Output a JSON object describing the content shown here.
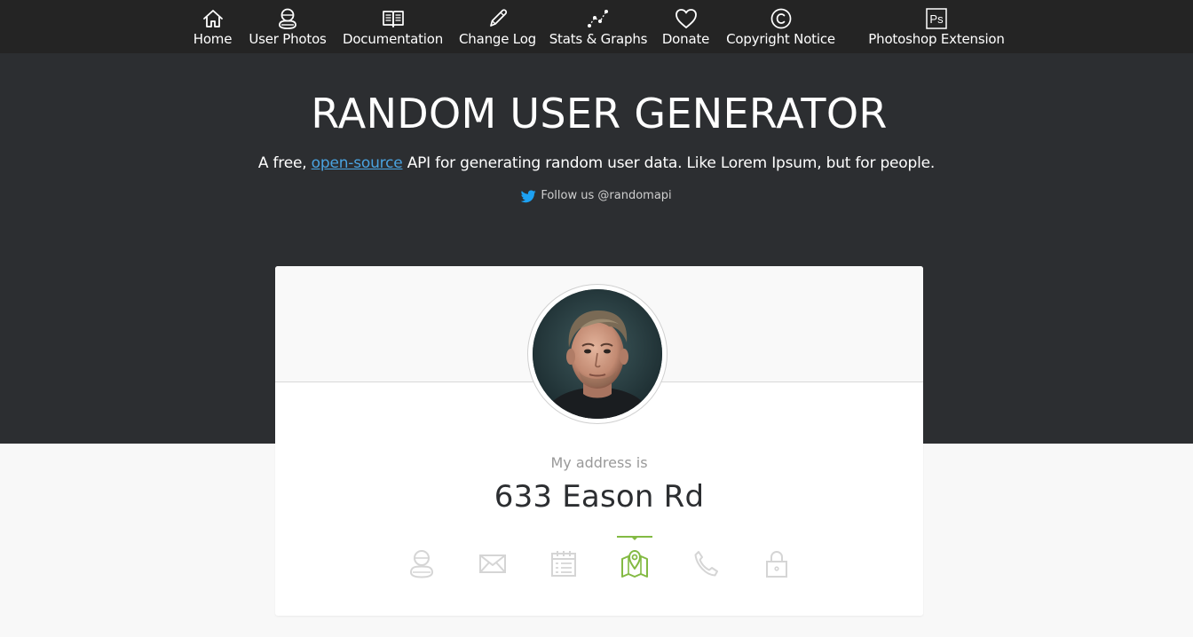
{
  "nav": {
    "items": [
      {
        "label": "Home",
        "icon": "home-icon"
      },
      {
        "label": "User Photos",
        "icon": "user-photos-icon"
      },
      {
        "label": "Documentation",
        "icon": "book-icon"
      },
      {
        "label": "Change Log",
        "icon": "pencil-icon"
      },
      {
        "label": "Stats & Graphs",
        "icon": "graph-icon"
      },
      {
        "label": "Donate",
        "icon": "heart-icon"
      },
      {
        "label": "Copyright Notice",
        "icon": "copyright-icon"
      },
      {
        "label": "Photoshop Extension",
        "icon": "photoshop-icon",
        "icon_text": "Ps"
      }
    ]
  },
  "hero": {
    "title": "RANDOM USER GENERATOR",
    "subtitle_before": "A free, ",
    "subtitle_link": "open-source",
    "subtitle_after": " API for generating random user data. Like Lorem Ipsum, but for people.",
    "follow_text": "Follow us @randomapi"
  },
  "user_card": {
    "label": "My address is",
    "value": "633 Eason Rd",
    "selected_tab": "location",
    "tabs": [
      {
        "name": "name",
        "icon": "user-icon"
      },
      {
        "name": "email",
        "icon": "envelope-icon"
      },
      {
        "name": "birthday",
        "icon": "calendar-icon"
      },
      {
        "name": "location",
        "icon": "map-icon"
      },
      {
        "name": "phone",
        "icon": "phone-icon"
      },
      {
        "name": "password",
        "icon": "lock-icon"
      }
    ]
  },
  "colors": {
    "nav_background": "#242424",
    "hero_background": "#2c2e31",
    "page_background": "#f8f8f8",
    "accent_green": "#83ba43",
    "link_blue": "#4aa3e0",
    "inactive_icon": "#d5d5d5"
  }
}
